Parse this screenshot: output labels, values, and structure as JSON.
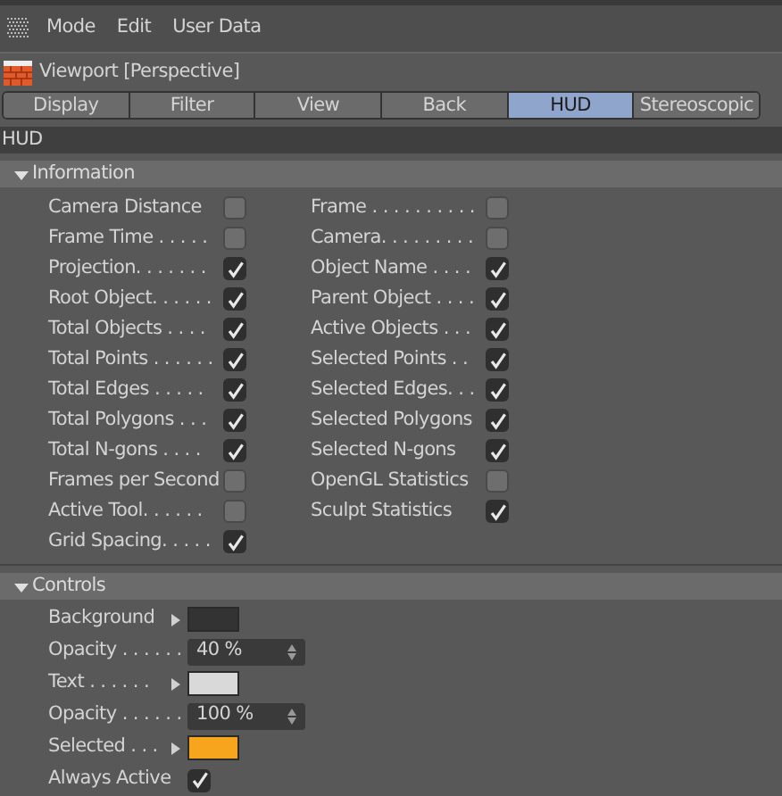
{
  "menu": [
    "Mode",
    "Edit",
    "User Data"
  ],
  "title": "Viewport [Perspective]",
  "tabs": [
    {
      "label": "Display",
      "selected": false
    },
    {
      "label": "Filter",
      "selected": false
    },
    {
      "label": "View",
      "selected": false
    },
    {
      "label": "Back",
      "selected": false
    },
    {
      "label": "HUD",
      "selected": true
    },
    {
      "label": "Stereoscopic",
      "selected": false
    }
  ],
  "section_title": "HUD",
  "information": {
    "title": "Information",
    "expanded": true,
    "items": [
      {
        "label": "Camera Distance",
        "checked": false
      },
      {
        "label": "Frame . . . . . . . . . .",
        "checked": false
      },
      {
        "label": "Frame Time . . . . .",
        "checked": false
      },
      {
        "label": "Camera. . . . . . . . .",
        "checked": false
      },
      {
        "label": "Projection. . . . . . .",
        "checked": true
      },
      {
        "label": "Object Name . . . .",
        "checked": true
      },
      {
        "label": "Root Object. . . . . .",
        "checked": true
      },
      {
        "label": "Parent Object . . . .",
        "checked": true
      },
      {
        "label": "Total Objects . . . .",
        "checked": true
      },
      {
        "label": "Active Objects . . .",
        "checked": true
      },
      {
        "label": "Total Points . . . . . .",
        "checked": true
      },
      {
        "label": "Selected Points . .",
        "checked": true
      },
      {
        "label": "Total Edges . . . . .",
        "checked": true
      },
      {
        "label": "Selected Edges. . .",
        "checked": true
      },
      {
        "label": "Total Polygons . . .",
        "checked": true
      },
      {
        "label": "Selected Polygons",
        "checked": true
      },
      {
        "label": "Total N-gons . . . .",
        "checked": true
      },
      {
        "label": "Selected N-gons",
        "checked": true
      },
      {
        "label": "Frames per Second",
        "checked": false
      },
      {
        "label": "OpenGL Statistics",
        "checked": false
      },
      {
        "label": "Active Tool. . . . . .",
        "checked": false
      },
      {
        "label": "Sculpt Statistics",
        "checked": true
      },
      {
        "label": "Grid Spacing. . . . .",
        "checked": true
      }
    ]
  },
  "controls": {
    "title": "Controls",
    "expanded": true,
    "items": [
      {
        "kind": "color",
        "label": "Background",
        "color": "#333333"
      },
      {
        "kind": "number",
        "label": "Opacity . . . . . .",
        "value": "40 %"
      },
      {
        "kind": "color",
        "label": "Text . . . . . .",
        "color": "#d9d9d9"
      },
      {
        "kind": "number",
        "label": "Opacity . . . . . .",
        "value": "100 %"
      },
      {
        "kind": "color",
        "label": "Selected . . .",
        "color": "#f7a51c"
      },
      {
        "kind": "check",
        "label": "Always Active",
        "checked": true
      }
    ]
  }
}
